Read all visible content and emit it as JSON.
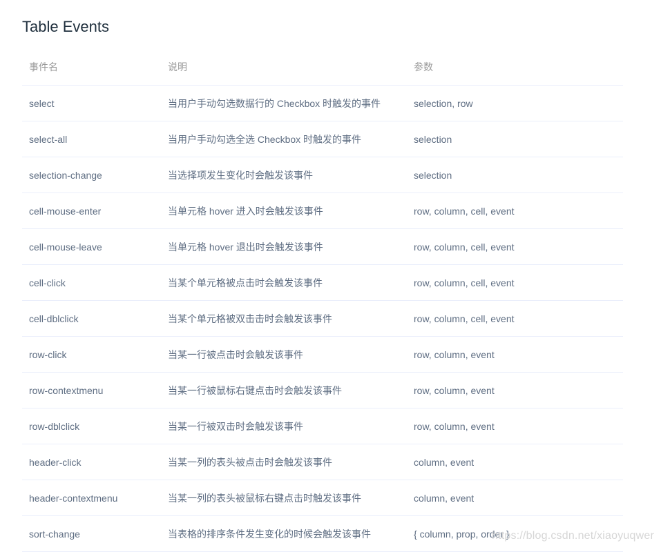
{
  "page": {
    "title": "Table Events"
  },
  "table": {
    "headers": [
      "事件名",
      "说明",
      "参数"
    ],
    "rows": [
      {
        "name": "select",
        "description": "当用户手动勾选数据行的 Checkbox 时触发的事件",
        "params": "selection, row"
      },
      {
        "name": "select-all",
        "description": "当用户手动勾选全选 Checkbox 时触发的事件",
        "params": "selection"
      },
      {
        "name": "selection-change",
        "description": "当选择项发生变化时会触发该事件",
        "params": "selection"
      },
      {
        "name": "cell-mouse-enter",
        "description": "当单元格 hover 进入时会触发该事件",
        "params": "row, column, cell, event"
      },
      {
        "name": "cell-mouse-leave",
        "description": "当单元格 hover 退出时会触发该事件",
        "params": "row, column, cell, event"
      },
      {
        "name": "cell-click",
        "description": "当某个单元格被点击时会触发该事件",
        "params": "row, column, cell, event"
      },
      {
        "name": "cell-dblclick",
        "description": "当某个单元格被双击击时会触发该事件",
        "params": "row, column, cell, event"
      },
      {
        "name": "row-click",
        "description": "当某一行被点击时会触发该事件",
        "params": "row, column, event"
      },
      {
        "name": "row-contextmenu",
        "description": "当某一行被鼠标右键点击时会触发该事件",
        "params": "row, column, event"
      },
      {
        "name": "row-dblclick",
        "description": "当某一行被双击时会触发该事件",
        "params": "row, column, event"
      },
      {
        "name": "header-click",
        "description": "当某一列的表头被点击时会触发该事件",
        "params": "column, event"
      },
      {
        "name": "header-contextmenu",
        "description": "当某一列的表头被鼠标右键点击时触发该事件",
        "params": "column, event"
      },
      {
        "name": "sort-change",
        "description": "当表格的排序条件发生变化的时候会触发该事件",
        "params": "{ column, prop, order }"
      }
    ]
  },
  "watermark": "https://blog.csdn.net/xiaoyuqwer",
  "colors": {
    "title": "#1f2f3d",
    "text": "#5e6d82",
    "header_text": "#999999",
    "border": "#eaeefb"
  }
}
